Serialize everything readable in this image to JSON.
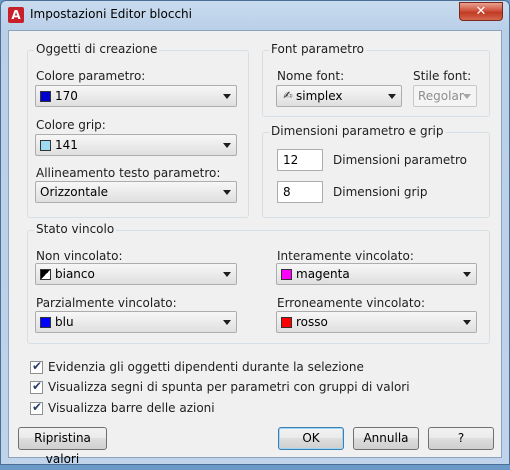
{
  "window": {
    "title": "Impostazioni Editor blocchi",
    "app_icon_letter": "A",
    "close_glyph": "✕"
  },
  "oggetti": {
    "title": "Oggetti di creazione",
    "colore_parametro": {
      "label": "Colore parametro:",
      "value": "170",
      "color": "#0000cc"
    },
    "colore_grip": {
      "label": "Colore grip:",
      "value": "141",
      "color": "#9fd9f2"
    },
    "allineamento": {
      "label": "Allineamento testo parametro:",
      "value": "Orizzontale"
    }
  },
  "font": {
    "title": "Font parametro",
    "nome_label": "Nome font:",
    "nome_value": "simplex",
    "nome_icon": "font-icon",
    "stile_label": "Stile font:",
    "stile_value": "Regolar"
  },
  "dimensioni": {
    "title": "Dimensioni parametro e grip",
    "parametro_value": "12",
    "parametro_label": "Dimensioni parametro",
    "grip_value": "8",
    "grip_label": "Dimensioni grip"
  },
  "stato": {
    "title": "Stato vincolo",
    "non_vincolato": {
      "label": "Non vincolato:",
      "value": "bianco",
      "color": "#ffffff"
    },
    "interamente": {
      "label": "Interamente vincolato:",
      "value": "magenta",
      "color": "#ff00ff"
    },
    "parzialmente": {
      "label": "Parzialmente vincolato:",
      "value": "blu",
      "color": "#0000ff"
    },
    "erroneamente": {
      "label": "Erroneamente vincolato:",
      "value": "rosso",
      "color": "#ff0000"
    }
  },
  "checks": [
    {
      "label": "Evidenzia gli oggetti dipendenti durante la selezione",
      "checked": true
    },
    {
      "label": "Visualizza segni di spunta per parametri con gruppi di valori",
      "checked": true
    },
    {
      "label": "Visualizza barre delle azioni",
      "checked": true
    }
  ],
  "buttons": {
    "reset": "Ripristina valori",
    "ok": "OK",
    "cancel": "Annulla",
    "help": "?"
  },
  "check_glyph": "✔"
}
